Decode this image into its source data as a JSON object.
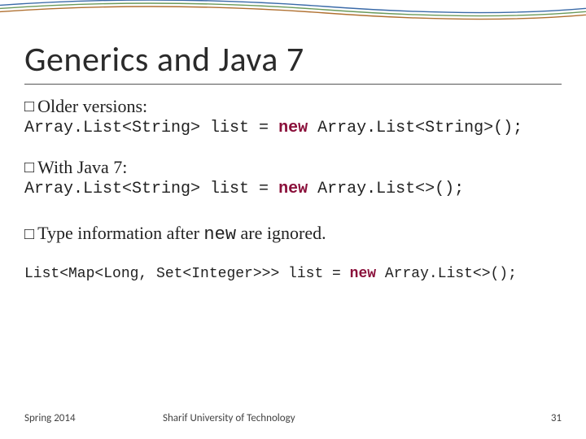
{
  "title": "Generics and Java 7",
  "bullets": {
    "older": "Older versions:",
    "java7": "With Java 7:",
    "ignored_pre": "Type information after ",
    "ignored_code": "new",
    "ignored_post": " are ignored."
  },
  "code": {
    "older_1": "Array.List<String> list = ",
    "older_kw": "new",
    "older_2": " Array.List<String>();",
    "java7_1": "Array.List<String> list = ",
    "java7_kw": "new",
    "java7_2": " Array.List<>();",
    "complex_1": "List<Map<Long, Set<Integer>>> list = ",
    "complex_kw": "new",
    "complex_2": " Array.List<>();"
  },
  "footer": {
    "left": "Spring 2014",
    "center": "Sharif University of Technology",
    "page": "31"
  },
  "glyphs": {
    "box": "□"
  }
}
